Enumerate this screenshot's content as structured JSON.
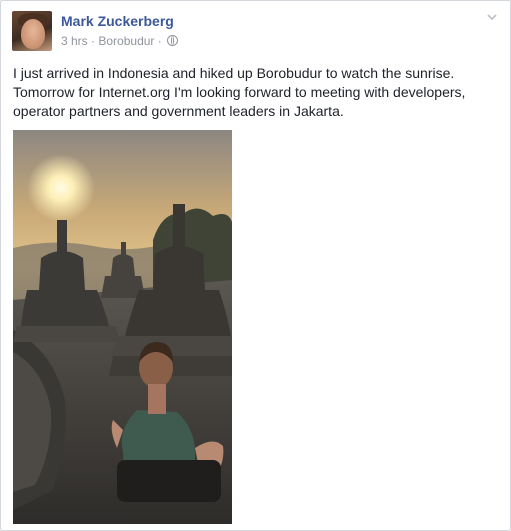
{
  "post": {
    "author": "Mark Zuckerberg",
    "time": "3 hrs",
    "separator": "·",
    "location": "Borobudur",
    "audience_icon": "globe-icon",
    "menu_icon": "chevron-down-icon",
    "text": "I just arrived in Indonesia and hiked up Borobudur to watch the sunrise. Tomorrow for Internet.org I'm looking forward to meeting with developers, operator partners and government leaders in Jakarta.",
    "photo_subject": "man sitting before stupas at sunrise"
  },
  "colors": {
    "author_link": "#3b5998",
    "meta_text": "#90949c",
    "body_text": "#1d2129"
  }
}
